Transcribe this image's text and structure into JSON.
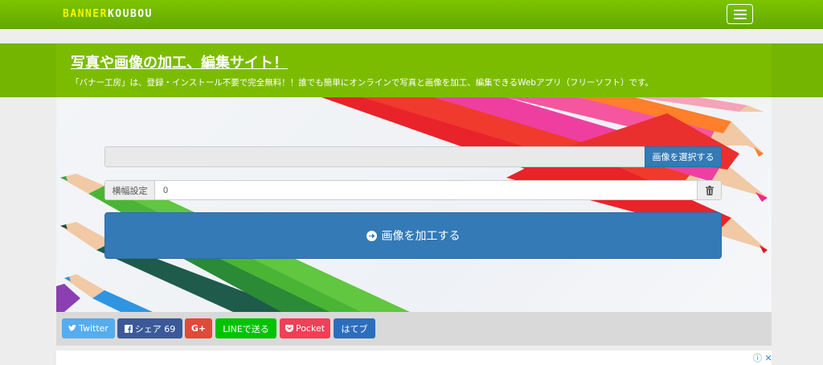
{
  "navbar": {
    "brand_part1": "BANNER",
    "brand_part2": "KOUBOU"
  },
  "header": {
    "title": "写真や画像の加工、編集サイト！",
    "subtitle": "「バナー工房」は、登録・インストール不要で完全無料！！誰でも簡単にオンラインで写真と画像を加工、編集できるWebアプリ（フリーソフト）です。"
  },
  "form": {
    "file_input_value": "",
    "select_image_button": "画像を選択する",
    "width_label": "横幅設定",
    "width_value": "0",
    "process_button": "画像を加工する"
  },
  "share": {
    "twitter": "Twitter",
    "facebook": "シェア 69",
    "google_plus": "G+",
    "line": "LINEで送る",
    "pocket": "Pocket",
    "hatena": "はてブ"
  },
  "ad": {
    "info": "ⓘ",
    "close": "✕"
  },
  "colors": {
    "brand_green": "#7cbc00",
    "primary_blue": "#337ab7",
    "twitter": "#55acee",
    "facebook": "#3b5998",
    "google_plus": "#dd4b39",
    "line": "#00c300",
    "pocket": "#ee4056",
    "hatena": "#2c6ebd"
  }
}
